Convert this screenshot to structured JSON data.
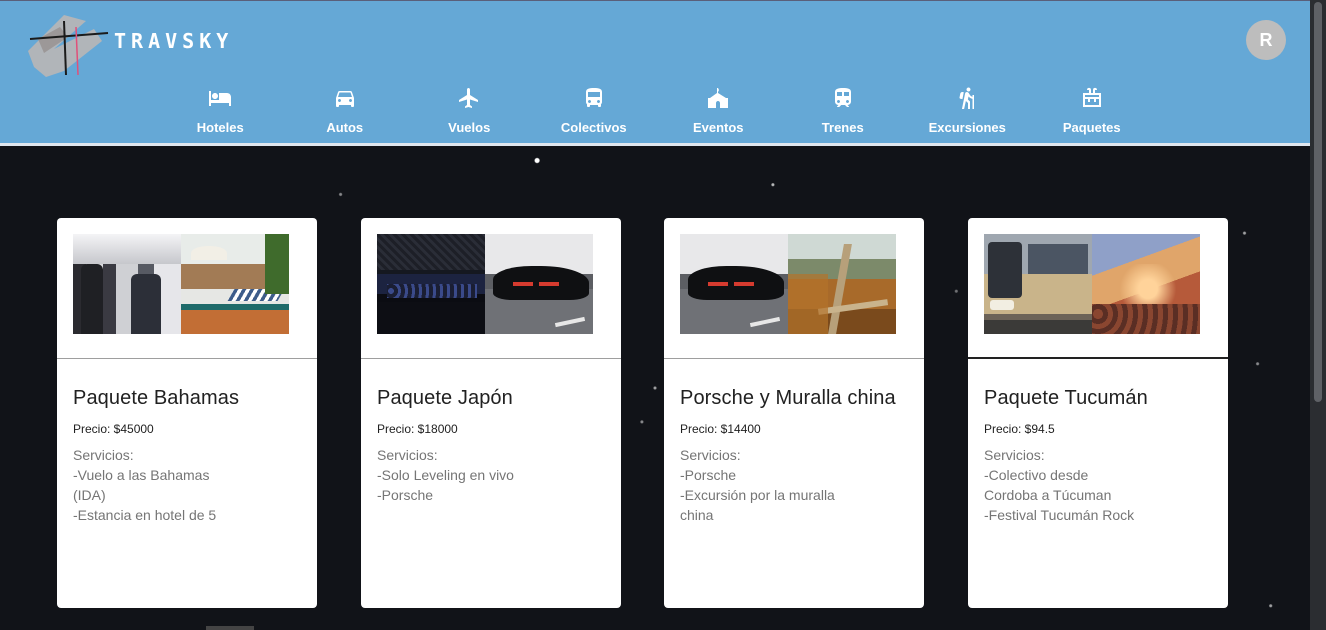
{
  "brand": {
    "name": "TRAVSKY"
  },
  "user": {
    "initial": "R"
  },
  "nav": [
    {
      "label": "Hoteles",
      "icon": "bed-icon"
    },
    {
      "label": "Autos",
      "icon": "car-icon"
    },
    {
      "label": "Vuelos",
      "icon": "airplane-icon"
    },
    {
      "label": "Colectivos",
      "icon": "bus-icon"
    },
    {
      "label": "Eventos",
      "icon": "venue-icon"
    },
    {
      "label": "Trenes",
      "icon": "train-icon"
    },
    {
      "label": "Excursiones",
      "icon": "hiking-icon"
    },
    {
      "label": "Paquetes",
      "icon": "package-icon"
    }
  ],
  "cards": [
    {
      "title": "Paquete Bahamas",
      "price": "Precio: $45000",
      "services_label": "Servicios:",
      "services": [
        "-Vuelo a las Bahamas (IDA)",
        "-Estancia en hotel de 5"
      ],
      "images": [
        "airplane-cabin-photo",
        "hotel-pool-photo"
      ]
    },
    {
      "title": "Paquete Japón",
      "price": "Precio: $18000",
      "services_label": "Servicios:",
      "services": [
        "-Solo Leveling en vivo",
        "-Porsche"
      ],
      "images": [
        "concert-crowd-photo",
        "black-porsche-photo"
      ]
    },
    {
      "title": "Porsche y Muralla china",
      "price": "Precio: $14400",
      "services_label": "Servicios:",
      "services": [
        "-Porsche",
        "-Excursión por la muralla china"
      ],
      "images": [
        "black-porsche-photo",
        "great-wall-photo"
      ]
    },
    {
      "title": "Paquete Tucumán",
      "price": "Precio: $94.5",
      "services_label": "Servicios:",
      "services": [
        "-Colectivo desde Cordoba a Túcuman",
        "-Festival Tucumán Rock"
      ],
      "images": [
        "coach-bus-photo",
        "festival-crowd-photo"
      ]
    }
  ],
  "colors": {
    "header": "#65a8d6",
    "background": "#111318",
    "card": "#ffffff",
    "title_text": "#212121",
    "muted_text": "#757575"
  }
}
